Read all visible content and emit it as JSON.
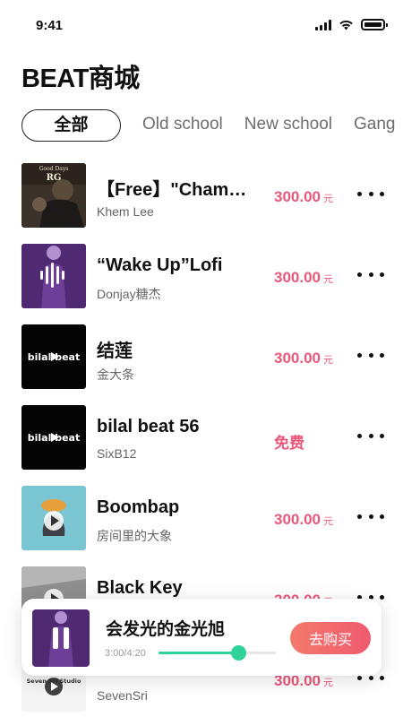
{
  "status_bar": {
    "time": "9:41",
    "icons": [
      "signal-icon",
      "wifi-icon",
      "battery-icon"
    ]
  },
  "page": {
    "title": "BEAT商城"
  },
  "tabs": [
    {
      "label": "全部",
      "active": true
    },
    {
      "label": "Old school",
      "active": false
    },
    {
      "label": "New school",
      "active": false
    },
    {
      "label": "Gang",
      "active": false
    }
  ],
  "tracks": [
    {
      "title": "【Free】\"Champion\"",
      "artist": "Khem Lee",
      "price": "300.00",
      "price_unit": "元",
      "cover_text": [
        "Good Days",
        "RG"
      ]
    },
    {
      "title": "“Wake Up”Lofi",
      "artist": "Donjay糖杰",
      "price": "300.00",
      "price_unit": "元"
    },
    {
      "title": "结莲",
      "artist": "金大条",
      "price": "300.00",
      "price_unit": "元",
      "cover_text": [
        "bilal beat"
      ]
    },
    {
      "title": "bilal beat 56",
      "artist": "SixB12",
      "price": "免费",
      "price_unit": "",
      "cover_text": [
        "bilal beat"
      ]
    },
    {
      "title": "Boombap",
      "artist": "房间里的大象",
      "price": "300.00",
      "price_unit": "元"
    },
    {
      "title": "Black Key",
      "artist": "",
      "price": "300.00",
      "price_unit": "元"
    },
    {
      "title": "",
      "artist": "SevenSri",
      "price": "300.00",
      "price_unit": "元",
      "cover_text": [
        "Seven Sri Studio"
      ]
    }
  ],
  "player": {
    "title": "会发光的金光旭",
    "time": "3:00/4:20",
    "progress_fraction": 0.69,
    "buy_label": "去购买"
  },
  "colors": {
    "accent_price": "#e9577b",
    "progress": "#2fd39a",
    "buy_button_start": "#f47a6d",
    "buy_button_end": "#ef5b6e"
  }
}
